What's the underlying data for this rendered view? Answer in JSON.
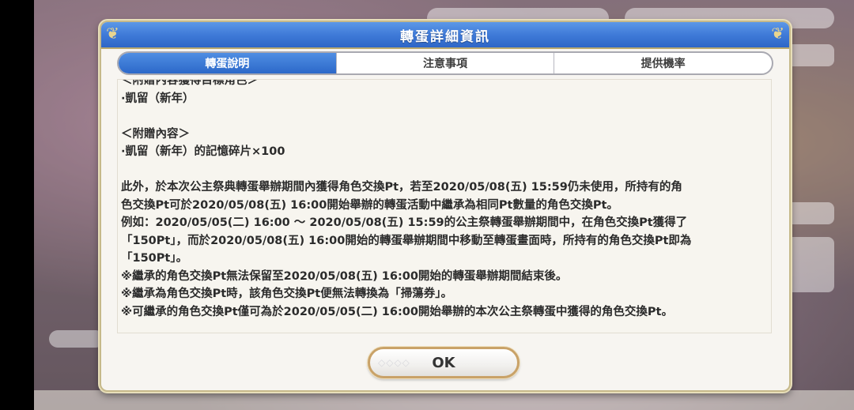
{
  "dialog": {
    "title": "轉蛋詳細資訊",
    "tabs": [
      {
        "label": "轉蛋說明",
        "active": true
      },
      {
        "label": "注意事項",
        "active": false
      },
      {
        "label": "提供機率",
        "active": false
      }
    ],
    "content_lines": [
      "＜附贈內容獲得目標角色＞",
      "·凱留（新年）",
      "",
      "＜附贈內容＞",
      "·凱留（新年）的記憶碎片×100",
      "",
      "此外，於本次公主祭典轉蛋舉辦期間內獲得角色交換Pt，若至2020/05/08(五) 15:59仍未使用，所持有的角",
      "色交換Pt可於2020/05/08(五) 16:00開始舉辦的轉蛋活動中繼承為相同Pt數量的角色交換Pt。",
      "例如：2020/05/05(二) 16:00 ～ 2020/05/08(五) 15:59的公主祭轉蛋舉辦期間中，在角色交換Pt獲得了",
      "「150Pt」，而於2020/05/08(五) 16:00開始的轉蛋舉辦期間中移動至轉蛋畫面時，所持有的角色交換Pt即為",
      "「150Pt」。",
      "※繼承的角色交換Pt無法保留至2020/05/08(五) 16:00開始的轉蛋舉辦期間結束後。",
      "※繼承為角色交換Pt時，該角色交換Pt便無法轉換為「掃蕩券」。",
      "※可繼承的角色交換Pt僅可為於2020/05/05(二) 16:00開始舉辦的本次公主祭轉蛋中獲得的角色交換Pt。"
    ],
    "ok_label": "OK"
  },
  "colors": {
    "header_blue": "#3f7ad8",
    "active_tab_blue": "#2c68c9",
    "gold_border": "#c9a268"
  }
}
